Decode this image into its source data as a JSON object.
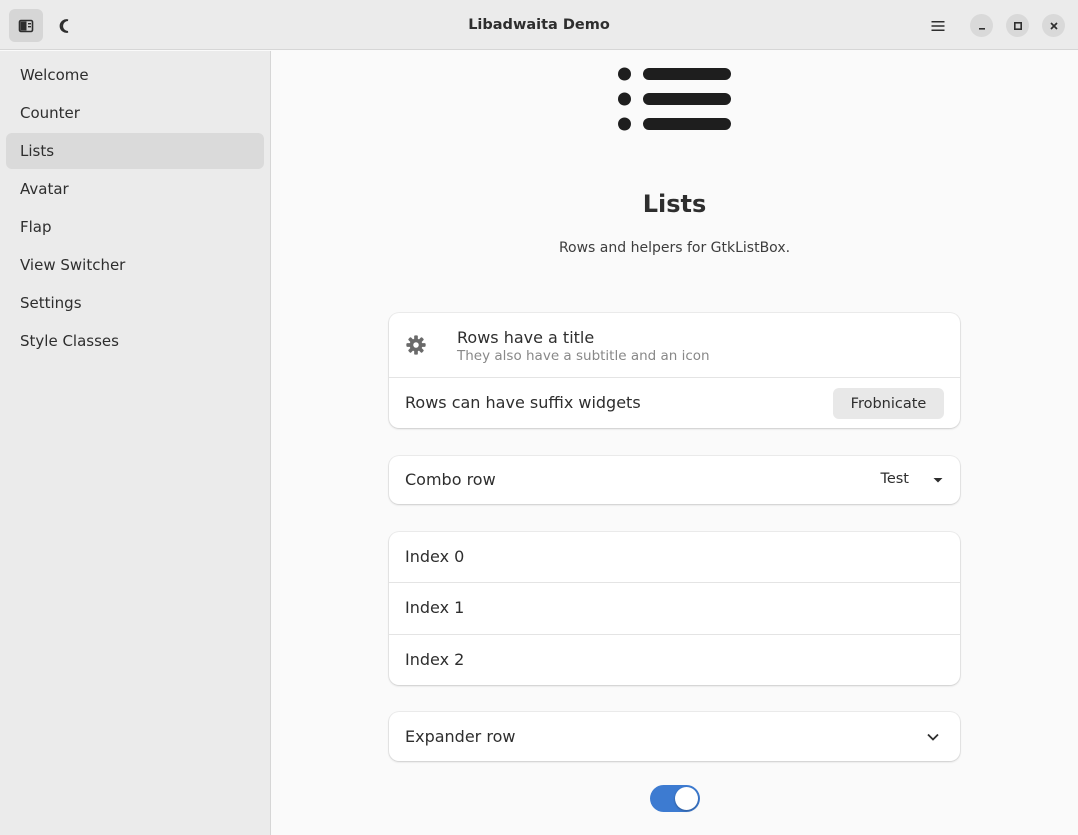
{
  "window": {
    "title": "Libadwaita Demo",
    "icons": {
      "sidebar_toggle": "sidebar-show-icon",
      "dark_mode": "moon-icon",
      "menu": "hamburger-menu-icon",
      "minimize": "minimize-icon",
      "maximize": "maximize-icon",
      "close": "close-icon"
    }
  },
  "sidebar": {
    "items": [
      {
        "label": "Welcome"
      },
      {
        "label": "Counter"
      },
      {
        "label": "Lists",
        "selected": true
      },
      {
        "label": "Avatar"
      },
      {
        "label": "Flap"
      },
      {
        "label": "View Switcher"
      },
      {
        "label": "Settings"
      },
      {
        "label": "Style Classes"
      }
    ]
  },
  "page": {
    "icon": "view-list-icon",
    "title": "Lists",
    "description": "Rows and helpers for GtkListBox."
  },
  "rows": {
    "title_row": {
      "icon": "gear-icon",
      "title": "Rows have a title",
      "subtitle": "They also have a subtitle and an icon"
    },
    "suffix_row": {
      "title": "Rows can have suffix widgets",
      "button": "Frobnicate"
    },
    "combo_row": {
      "title": "Combo row",
      "value": "Test"
    },
    "index_rows": [
      {
        "label": "Index 0"
      },
      {
        "label": "Index 1"
      },
      {
        "label": "Index 2"
      }
    ],
    "expander_row": {
      "title": "Expander row"
    }
  },
  "toggle_switch": {
    "on": true
  },
  "colors": {
    "accent": "#3d7bd1",
    "headerbar": "#ebebeb",
    "sidebar_selected": "#dadada",
    "card": "#ffffff"
  }
}
